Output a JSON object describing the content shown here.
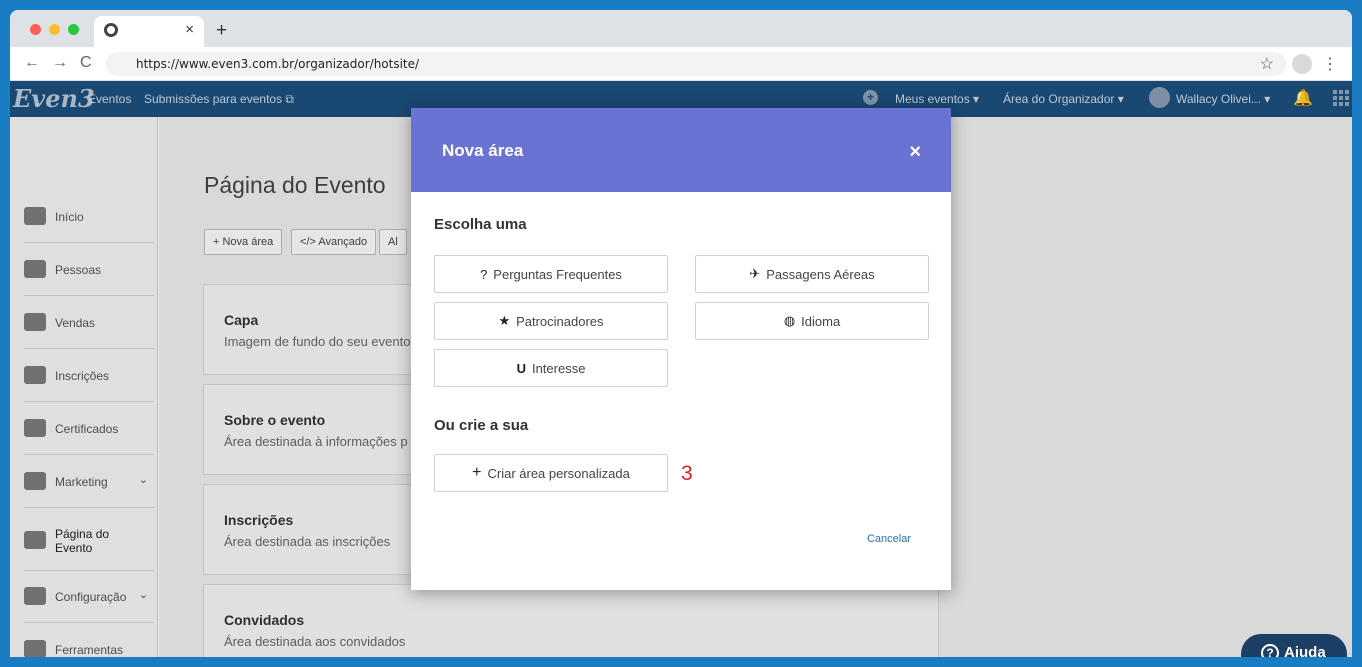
{
  "browser": {
    "url": "https://www.even3.com.br/organizador/hotsite/",
    "tab_close": "×",
    "new_tab": "+",
    "back": "←",
    "forward": "→",
    "reload": "C",
    "bookmark": "☆",
    "menu": "⋮",
    "traffic_lights": [
      "#ff5f57",
      "#febc2e",
      "#28c840"
    ]
  },
  "header": {
    "logo": "Even3",
    "nav": [
      "Eventos",
      "Submissões para eventos"
    ],
    "add": "+",
    "meus_eventos": "Meus eventos ▾",
    "area_organizador": "Área do Organizador ▾",
    "user": "Wallacy Olivei... ▾",
    "bell": "🔔"
  },
  "sidebar": {
    "items": [
      {
        "label": "Início"
      },
      {
        "label": "Pessoas"
      },
      {
        "label": "Vendas"
      },
      {
        "label": "Inscrições"
      },
      {
        "label": "Certificados"
      },
      {
        "label": "Marketing",
        "chevron": "⌄"
      },
      {
        "label": "Página do Evento"
      },
      {
        "label": "Configuração",
        "chevron": "⌄"
      },
      {
        "label": "Ferramentas"
      }
    ]
  },
  "main": {
    "title": "Página do Evento",
    "toolbar": [
      "+ Nova área",
      "</> Avançado",
      "Al"
    ],
    "cards": [
      {
        "title": "Capa",
        "desc": "Imagem de fundo do seu evento"
      },
      {
        "title": "Sobre o evento",
        "desc": "Área destinada à informações p"
      },
      {
        "title": "Inscrições",
        "desc": "Área destinada as inscrições"
      },
      {
        "title": "Convidados",
        "desc": "Área destinada aos convidados"
      }
    ]
  },
  "modal": {
    "title": "Nova área",
    "close": "×",
    "choose_heading": "Escolha uma",
    "options": [
      {
        "label": "Perguntas Frequentes",
        "icon": "?"
      },
      {
        "label": "Passagens Aéreas",
        "icon": "✈"
      },
      {
        "label": "Patrocinadores",
        "icon": "★"
      },
      {
        "label": "Idioma",
        "icon": "◍"
      },
      {
        "label": "Interesse",
        "icon": "U"
      }
    ],
    "create_heading": "Ou crie a sua",
    "create_label": "Criar área personalizada",
    "create_icon": "+",
    "step": "3",
    "cancel": "Cancelar"
  },
  "help": {
    "label": "Ajuda",
    "icon": "?"
  }
}
